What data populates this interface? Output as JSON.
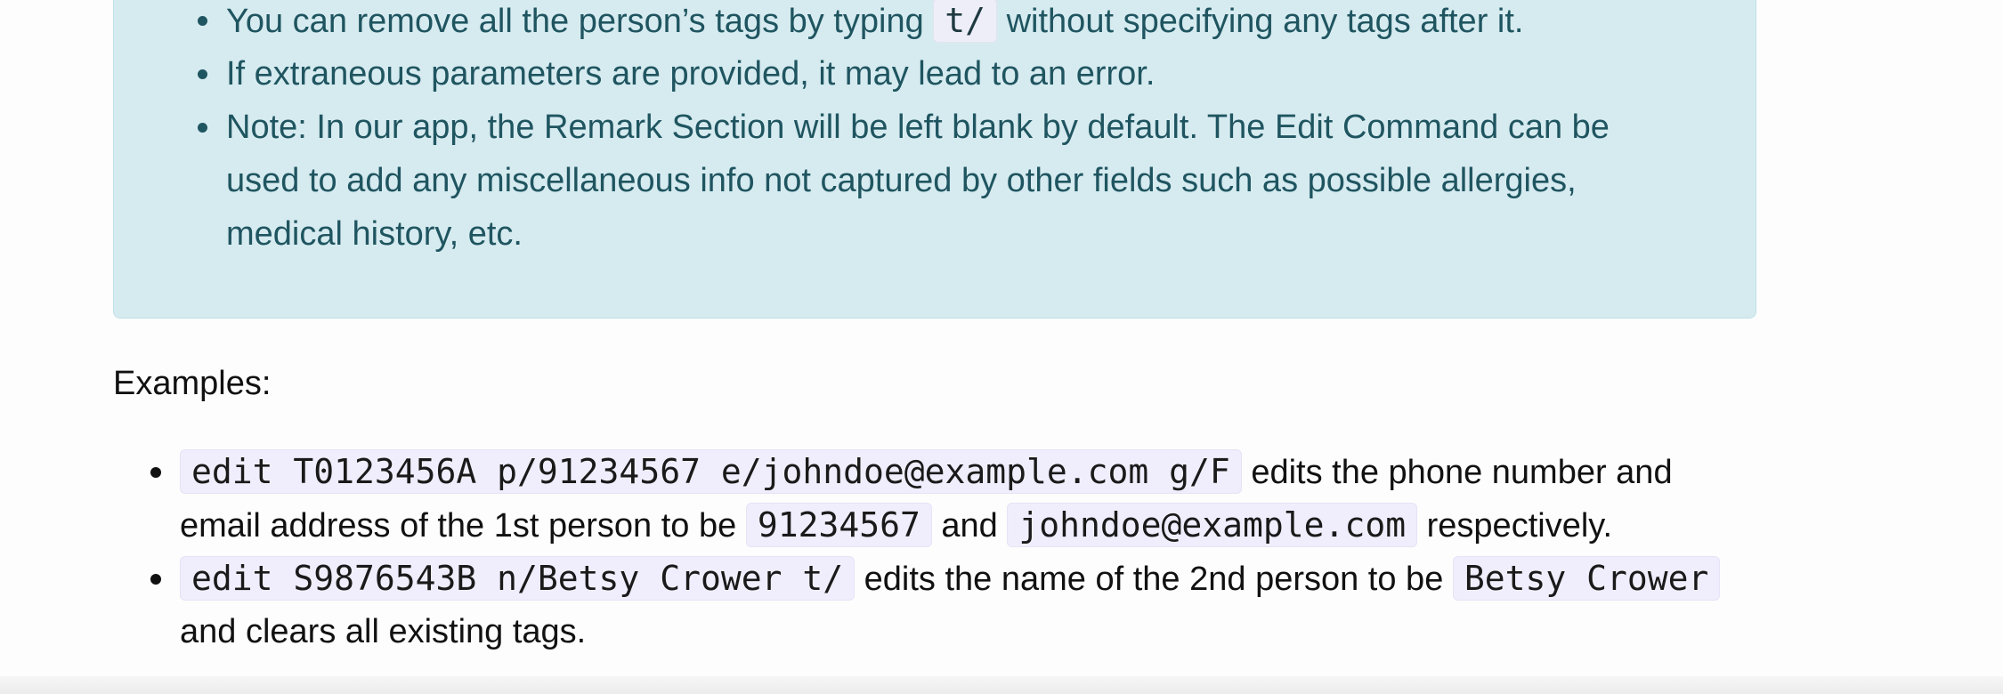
{
  "info_box": {
    "items": [
      {
        "before": "You can remove all the person’s tags by typing ",
        "code": "t/",
        "after": " without specifying any tags after it."
      },
      {
        "text": "If extraneous parameters are provided, it may lead to an error."
      },
      {
        "line1": "Note: In our app, the Remark Section will be left blank by default. The Edit Command can be",
        "line2": "used to add any miscellaneous info not captured by other fields such as possible allergies,",
        "line3": "medical history, etc."
      }
    ]
  },
  "examples": {
    "title": "Examples:",
    "items": [
      {
        "code1": "edit T0123456A p/91234567 e/johndoe@example.com g/F",
        "text1": " edits the phone number and",
        "text2": "email address of the 1st person to be ",
        "code2": "91234567",
        "text3": " and ",
        "code3": "johndoe@example.com",
        "text4": " respectively."
      },
      {
        "code1": "edit S9876543B n/Betsy Crower t/",
        "text1": " edits the name of the 2nd person to be ",
        "code2": "Betsy Crower",
        "text2": "and clears all existing tags."
      }
    ]
  }
}
